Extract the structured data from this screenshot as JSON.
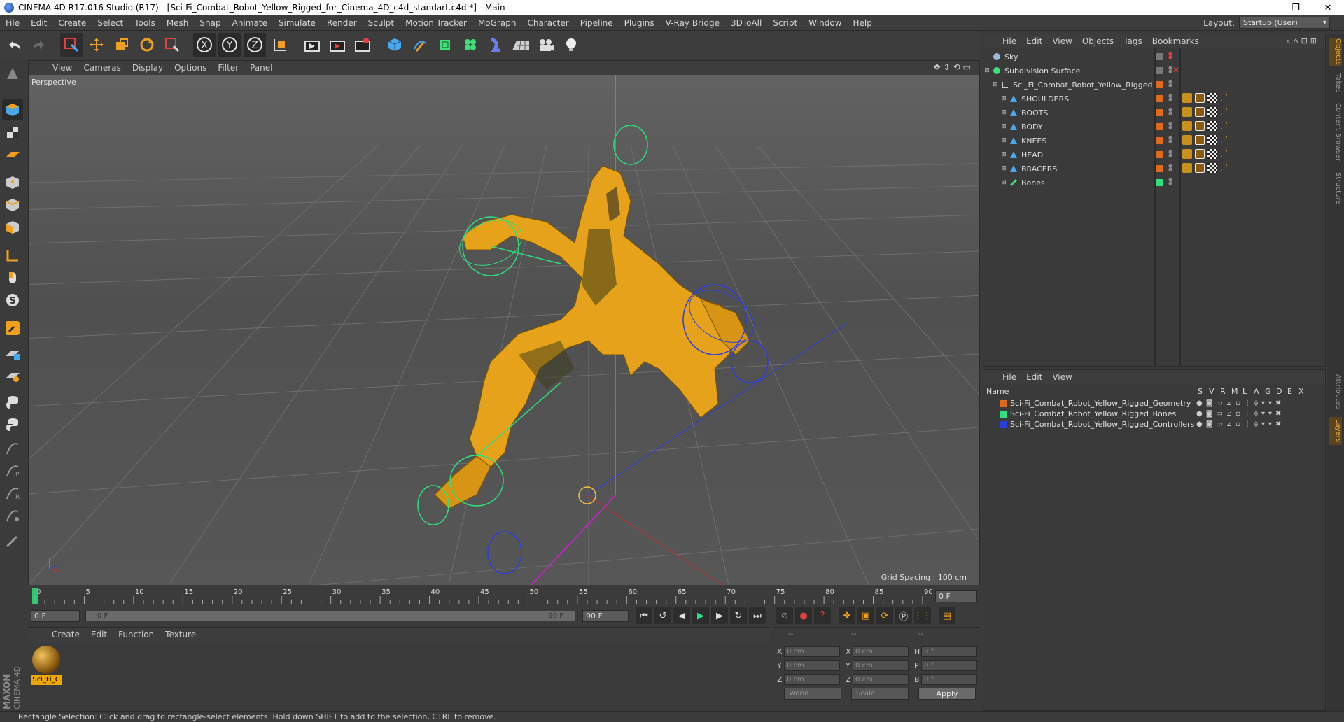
{
  "window": {
    "title": "CINEMA 4D R17.016 Studio (R17) - [Sci-Fi_Combat_Robot_Yellow_Rigged_for_Cinema_4D_c4d_standart.c4d *] - Main",
    "minimize": "—",
    "maximize": "❐",
    "close": "✕"
  },
  "menu": {
    "items": [
      "File",
      "Edit",
      "Create",
      "Select",
      "Tools",
      "Mesh",
      "Snap",
      "Animate",
      "Simulate",
      "Render",
      "Sculpt",
      "Motion Tracker",
      "MoGraph",
      "Character",
      "Pipeline",
      "Plugins",
      "V-Ray Bridge",
      "3DToAll",
      "Script",
      "Window",
      "Help"
    ],
    "layout_label": "Layout:",
    "layout_value": "Startup (User)"
  },
  "toolbar": {
    "icons": [
      "undo-icon",
      "redo-icon",
      "live-select-icon",
      "move-icon",
      "scale-icon",
      "rotate-icon",
      "recent-tool-icon",
      "x-axis-icon",
      "y-axis-icon",
      "z-axis-icon",
      "coordinate-system-icon",
      "render-view-icon",
      "render-picture-viewer-icon",
      "edit-render-settings-icon",
      "cube-icon",
      "pen-icon",
      "subdivision-icon",
      "cloner-icon",
      "deformer-icon",
      "floor-icon",
      "camera-icon",
      "light-icon"
    ],
    "axis_x": "X",
    "axis_y": "Y",
    "axis_z": "Z"
  },
  "viewport": {
    "menu": [
      "View",
      "Cameras",
      "Display",
      "Options",
      "Filter",
      "Panel"
    ],
    "label": "Perspective",
    "grid_info": "Grid Spacing : 100 cm",
    "nav_icons": "✥⇕⟲▭"
  },
  "timeline": {
    "ticks": [
      "0",
      "5",
      "10",
      "15",
      "20",
      "25",
      "30",
      "35",
      "40",
      "45",
      "50",
      "55",
      "60",
      "65",
      "70",
      "75",
      "80",
      "85",
      "90"
    ],
    "current_frame": "0 F",
    "start": "0 F",
    "range_start": "0 F",
    "range_end": "90 F",
    "end": "90 F"
  },
  "material": {
    "menu": [
      "Create",
      "Edit",
      "Function",
      "Texture"
    ],
    "name": "Sci_Fi_C"
  },
  "coords": {
    "header": [
      "--",
      "--",
      "--"
    ],
    "rows": [
      {
        "a": "X",
        "av": "0 cm",
        "b": "X",
        "bv": "0 cm",
        "c": "H",
        "cv": "0 °"
      },
      {
        "a": "Y",
        "av": "0 cm",
        "b": "Y",
        "bv": "0 cm",
        "c": "P",
        "cv": "0 °"
      },
      {
        "a": "Z",
        "av": "0 cm",
        "b": "Z",
        "bv": "0 cm",
        "c": "B",
        "cv": "0 °"
      }
    ],
    "world": "World",
    "scale": "Scale",
    "apply": "Apply"
  },
  "objects": {
    "menu": [
      "File",
      "Edit",
      "View",
      "Objects",
      "Tags",
      "Bookmarks"
    ],
    "items": [
      {
        "name": "Sky",
        "indent": 0,
        "color": "#9a9a9a"
      },
      {
        "name": "Subdivision Surface",
        "indent": 0,
        "color": "#3ee07a"
      },
      {
        "name": "Sci_Fi_Combat_Robot_Yellow_Rigged",
        "indent": 1,
        "color": "#e06a1c"
      },
      {
        "name": "SHOULDERS",
        "indent": 2,
        "color": "#e06a1c"
      },
      {
        "name": "BOOTS",
        "indent": 2,
        "color": "#e06a1c"
      },
      {
        "name": "BODY",
        "indent": 2,
        "color": "#e06a1c"
      },
      {
        "name": "KNEES",
        "indent": 2,
        "color": "#e06a1c"
      },
      {
        "name": "HEAD",
        "indent": 2,
        "color": "#e06a1c"
      },
      {
        "name": "BRACERS",
        "indent": 2,
        "color": "#e06a1c"
      },
      {
        "name": "Bones",
        "indent": 2,
        "color": "#2ee07e"
      }
    ]
  },
  "layers": {
    "menu": [
      "File",
      "Edit",
      "View"
    ],
    "header_name": "Name",
    "header_cols": [
      "S",
      "V",
      "R",
      "M",
      "L",
      "A",
      "G",
      "D",
      "E",
      "X"
    ],
    "items": [
      {
        "name": "Sci-Fi_Combat_Robot_Yellow_Rigged_Geometry",
        "color": "#e06a1c"
      },
      {
        "name": "Sci-Fi_Combat_Robot_Yellow_Rigged_Bones",
        "color": "#2ee07e"
      },
      {
        "name": "Sci-Fi_Combat_Robot_Yellow_Rigged_Controllers",
        "color": "#2a3ee0"
      }
    ]
  },
  "right_tabs": [
    "Objects",
    "Takes",
    "Content Browser",
    "Structure",
    "Attributes",
    "Layers"
  ],
  "status": "Rectangle Selection: Click and drag to rectangle-select elements. Hold down SHIFT to add to the selection, CTRL to remove.",
  "logo": {
    "line1": "MAXON",
    "line2": "CINEMA 4D"
  }
}
